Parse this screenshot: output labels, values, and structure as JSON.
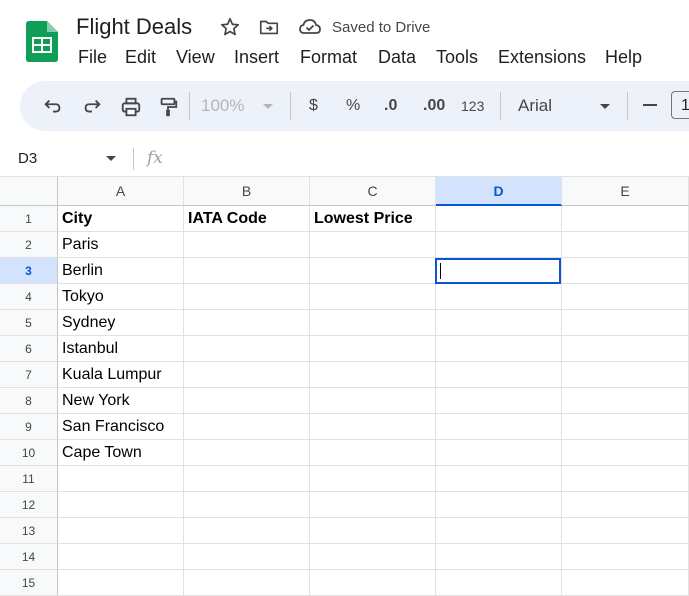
{
  "app": {
    "doc_title": "Flight Deals",
    "save_status": "Saved to Drive"
  },
  "menu": [
    "File",
    "Edit",
    "View",
    "Insert",
    "Format",
    "Data",
    "Tools",
    "Extensions",
    "Help"
  ],
  "toolbar": {
    "zoom": "100%",
    "currency": "$",
    "percent": "%",
    "decrease_decimal": ".0",
    "increase_decimal": ".00",
    "number_format": "123",
    "font": "Arial",
    "font_size": "1"
  },
  "formula_bar": {
    "name_box": "D3",
    "fx": "fx"
  },
  "columns": [
    "A",
    "B",
    "C",
    "D",
    "E"
  ],
  "selected_column": "D",
  "rows": [
    "1",
    "2",
    "3",
    "4",
    "5",
    "6",
    "7",
    "8",
    "9",
    "10",
    "11",
    "12",
    "13",
    "14",
    "15"
  ],
  "selected_row": "3",
  "cells": {
    "A": [
      "City",
      "Paris",
      "Berlin",
      "Tokyo",
      "Sydney",
      "Istanbul",
      "Kuala Lumpur",
      "New York",
      "San Francisco",
      "Cape Town"
    ],
    "B": [
      "IATA Code"
    ],
    "C": [
      "Lowest Price"
    ]
  },
  "colors": {
    "accent": "#0b57d0",
    "selection_bg": "#d3e3fd",
    "toolbar_bg": "#edf2fa",
    "sheets_green": "#0f9d58"
  }
}
